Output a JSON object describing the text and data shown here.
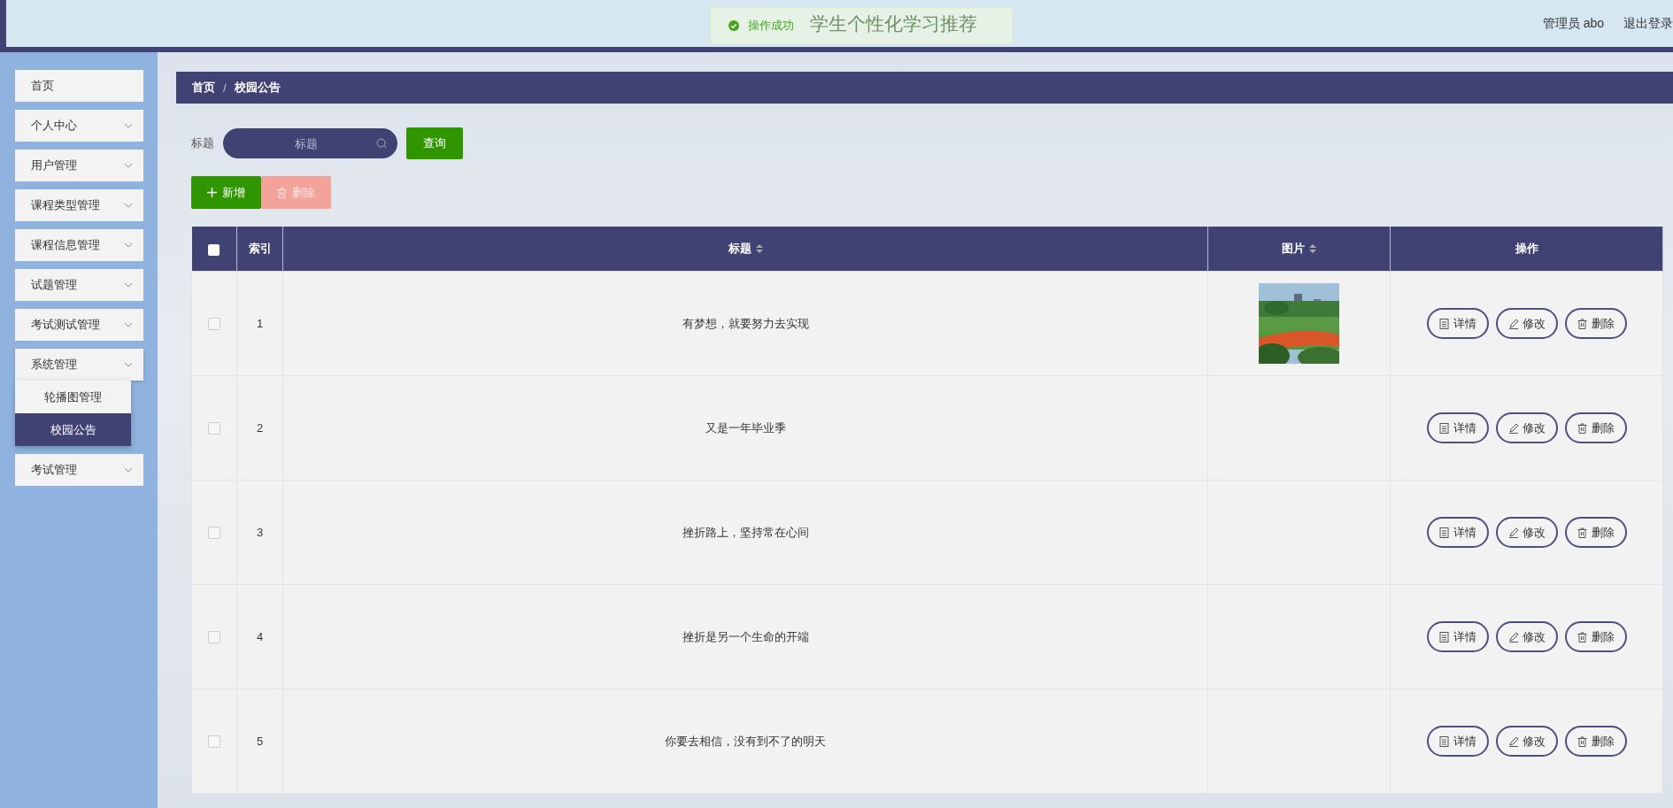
{
  "header": {
    "title": "学生个性化学习推荐",
    "user": "管理员 abo",
    "logout": "退出登录"
  },
  "toast": {
    "kind": "success",
    "message": "操作成功"
  },
  "sidebar": {
    "items": [
      {
        "label": "首页",
        "expandable": false,
        "expanded": false
      },
      {
        "label": "个人中心",
        "expandable": true,
        "expanded": false
      },
      {
        "label": "用户管理",
        "expandable": true,
        "expanded": false
      },
      {
        "label": "课程类型管理",
        "expandable": true,
        "expanded": false
      },
      {
        "label": "课程信息管理",
        "expandable": true,
        "expanded": false
      },
      {
        "label": "试题管理",
        "expandable": true,
        "expanded": false
      },
      {
        "label": "考试测试管理",
        "expandable": true,
        "expanded": false
      },
      {
        "label": "系统管理",
        "expandable": true,
        "expanded": true,
        "children": [
          {
            "label": "轮播图管理",
            "selected": false
          },
          {
            "label": "校园公告",
            "selected": true
          }
        ]
      },
      {
        "label": "考试管理",
        "expandable": true,
        "expanded": false
      }
    ]
  },
  "breadcrumb": {
    "items": [
      "首页",
      "校园公告"
    ],
    "separator": "/"
  },
  "search": {
    "label": "标题",
    "placeholder": "标题",
    "button": "查询"
  },
  "actions": [
    {
      "kind": "add",
      "label": "新增",
      "disabled": false
    },
    {
      "kind": "delete",
      "label": "删除",
      "disabled": true
    }
  ],
  "table": {
    "columns": [
      {
        "kind": "check",
        "checked": false
      },
      {
        "kind": "text",
        "label": "索引",
        "sortable": false
      },
      {
        "kind": "text",
        "label": "标题",
        "sortable": true
      },
      {
        "kind": "text",
        "label": "图片",
        "sortable": true
      },
      {
        "kind": "text",
        "label": "操作",
        "sortable": false
      }
    ],
    "rows": [
      {
        "checked": false,
        "index": "1",
        "title": "有梦想，就要努力去实现",
        "actions": [
          "详情",
          "修改",
          "删除"
        ]
      },
      {
        "checked": false,
        "index": "2",
        "title": "又是一年毕业季",
        "actions": [
          "详情",
          "修改",
          "删除"
        ]
      },
      {
        "checked": false,
        "index": "3",
        "title": "挫折路上，坚持常在心间",
        "actions": [
          "详情",
          "修改",
          "删除"
        ]
      },
      {
        "checked": false,
        "index": "4",
        "title": "挫折是另一个生命的开端",
        "actions": [
          "详情",
          "修改",
          "删除"
        ]
      },
      {
        "checked": false,
        "index": "5",
        "title": "你要去相信，没有到不了的明天",
        "actions": [
          "详情",
          "修改",
          "删除"
        ]
      }
    ]
  }
}
